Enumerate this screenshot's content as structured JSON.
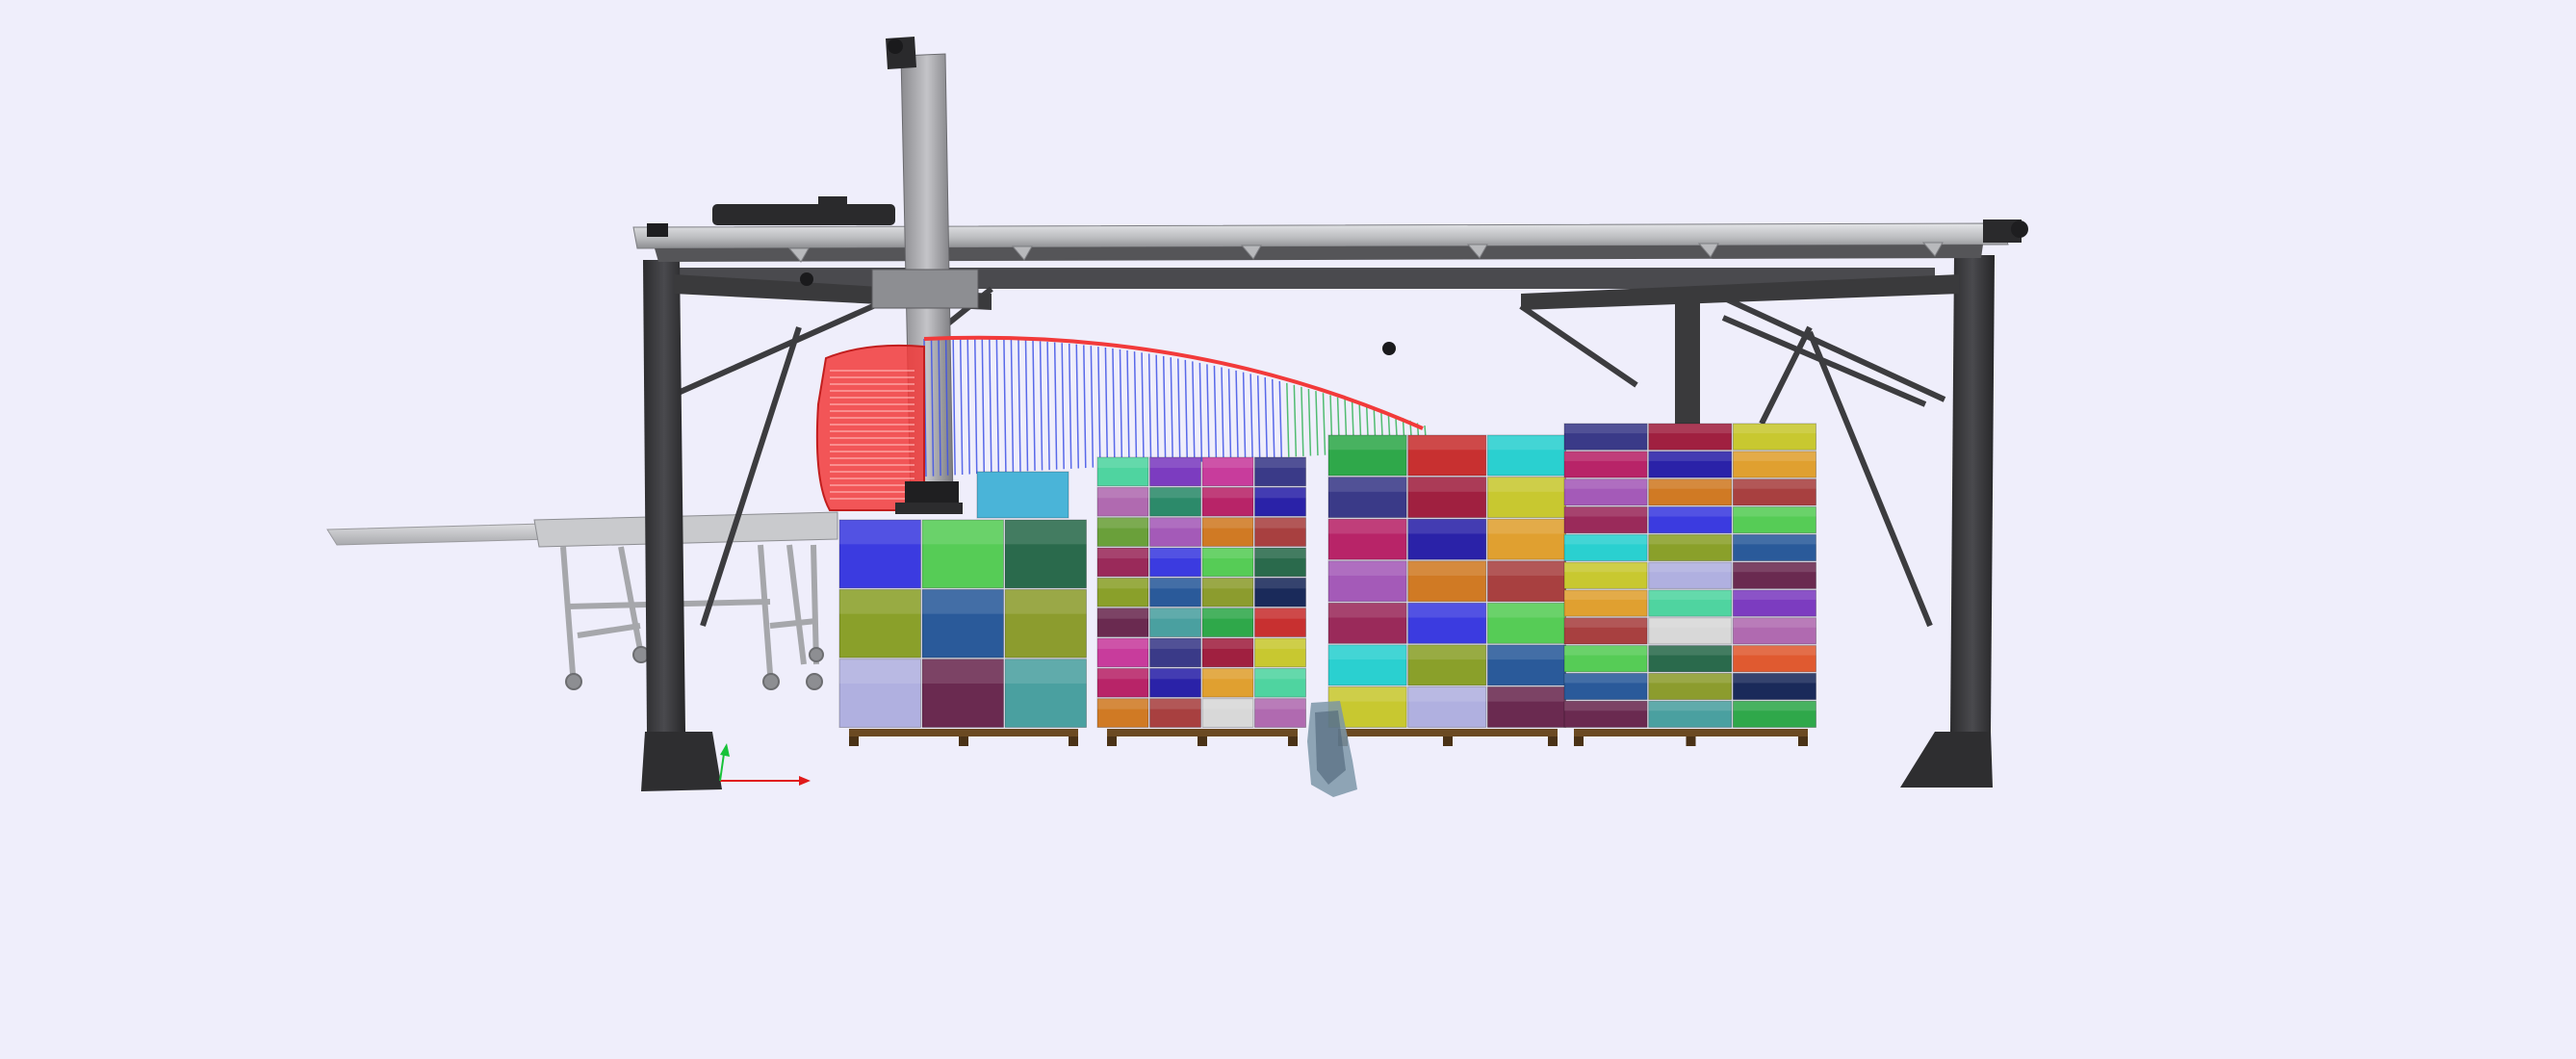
{
  "viewer": {
    "background": "#efeefb",
    "scene": "robot-gantry-palletizing-simulation",
    "show_axes": true,
    "show_trajectory": true,
    "axes_colors": {
      "x": "#e01a1a",
      "y": "#18c23a"
    }
  },
  "colors": {
    "frame_dark": "#3a3a3c",
    "frame_mid": "#5a5a5e",
    "rail_light": "#cfd0d4",
    "gripper_red": "#f23a3a",
    "trajectory_blue": "#3f52e6",
    "trajectory_green": "#36b45a",
    "pallet_wood": "#6b4a22"
  },
  "box_palette": [
    "#3b3be0",
    "#2fa84a",
    "#4fd4a0",
    "#a45ab8",
    "#8c9c2e",
    "#c8c830",
    "#2c8a6a",
    "#56cc56",
    "#c83030",
    "#7c3cc0",
    "#d07a24",
    "#1a2a5a",
    "#b0b0e0",
    "#b82468",
    "#2a6a4c",
    "#2ad0d0",
    "#c83c9c",
    "#a84040",
    "#3a8ad0",
    "#6a2a50",
    "#2a22a8",
    "#e05a30",
    "#8aa02a",
    "#3a3a88",
    "#d8d8d8",
    "#9a2a5a",
    "#4aa0a0",
    "#e0a030",
    "#6aa03a",
    "#2a5a9a",
    "#a02040",
    "#b06ab0"
  ]
}
